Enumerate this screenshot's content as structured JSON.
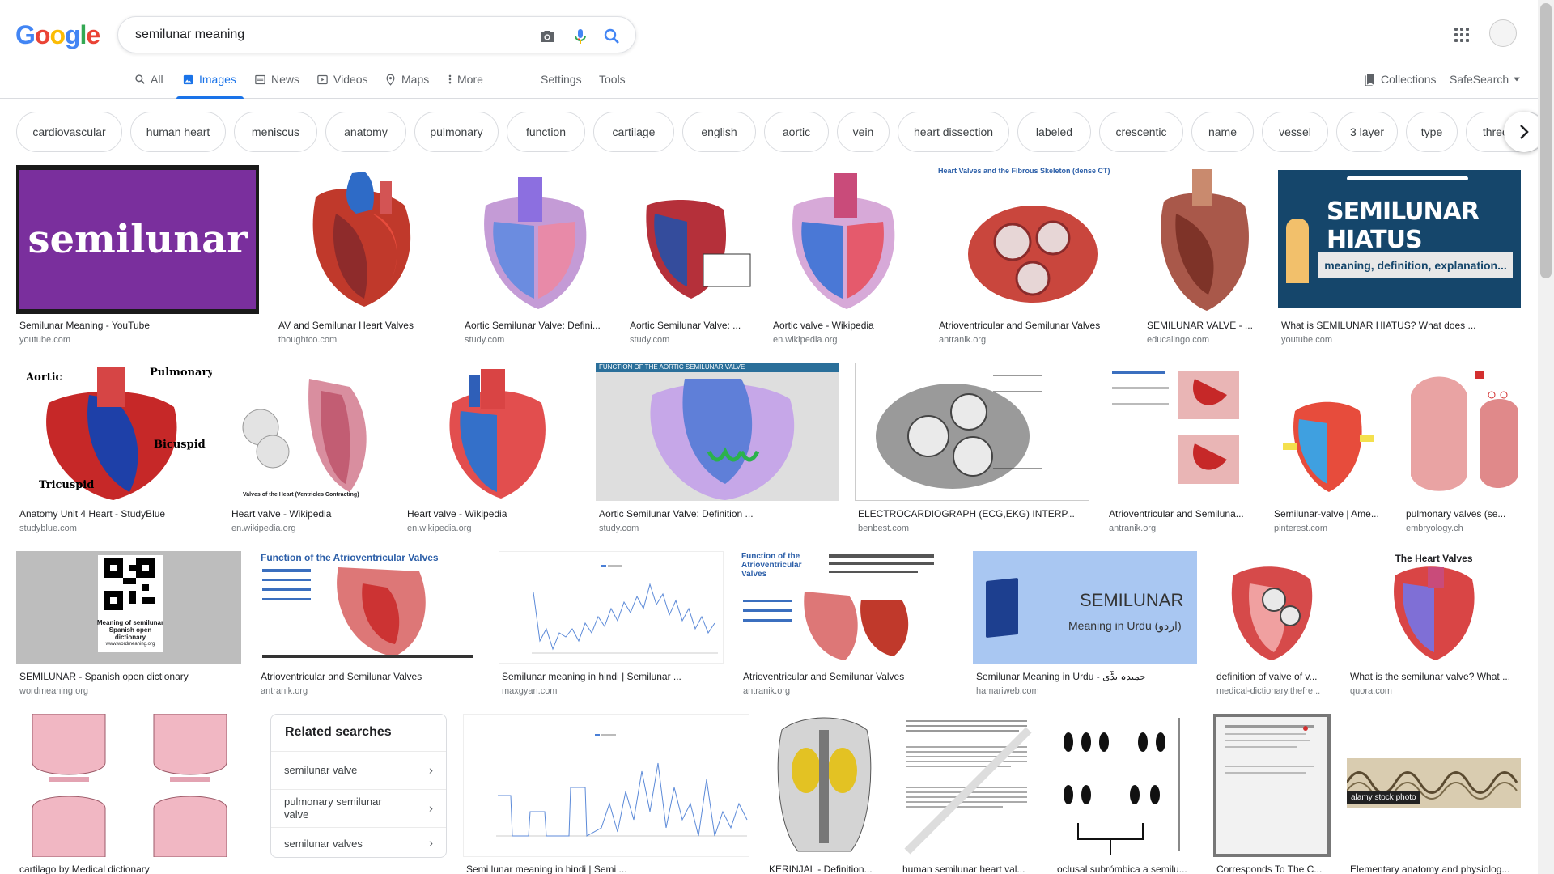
{
  "logo": {
    "letters": [
      "G",
      "o",
      "o",
      "g",
      "l",
      "e"
    ],
    "colors": [
      "#4285f4",
      "#ea4335",
      "#fbbc05",
      "#4285f4",
      "#34a853",
      "#ea4335"
    ]
  },
  "search": {
    "query": "semilunar meaning"
  },
  "tabs": [
    {
      "label": "All",
      "icon": "search-icon"
    },
    {
      "label": "Images",
      "icon": "image-icon"
    },
    {
      "label": "News",
      "icon": "news-icon"
    },
    {
      "label": "Videos",
      "icon": "video-icon"
    },
    {
      "label": "Maps",
      "icon": "map-icon"
    },
    {
      "label": "More",
      "icon": "more-vert-icon"
    },
    {
      "label": "Settings"
    },
    {
      "label": "Tools"
    }
  ],
  "right_tools": {
    "collections": "Collections",
    "safesearch": "SafeSearch"
  },
  "chips": [
    "cardiovascular",
    "human heart",
    "meniscus",
    "anatomy",
    "pulmonary",
    "function",
    "cartilage",
    "english",
    "aortic",
    "vein",
    "heart dissection",
    "labeled",
    "crescentic",
    "name",
    "vessel",
    "3 layer",
    "type",
    "three flap"
  ],
  "results_row1": [
    {
      "caption": "Semilunar Meaning - YouTube",
      "source": "youtube.com",
      "overlay": "semilunar"
    },
    {
      "caption": "AV and Semilunar Heart Valves",
      "source": "thoughtco.com"
    },
    {
      "caption": "Aortic Semilunar Valve: Defini...",
      "source": "study.com"
    },
    {
      "caption": "Aortic Semilunar Valve: ...",
      "source": "study.com"
    },
    {
      "caption": "Aortic valve - Wikipedia",
      "source": "en.wikipedia.org"
    },
    {
      "caption": "Atrioventricular and Semilunar Valves",
      "source": "antranik.org",
      "overlay": "Heart Valves and the Fibrous Skeleton (dense CT)"
    },
    {
      "caption": "SEMILUNAR VALVE - ...",
      "source": "educalingo.com"
    },
    {
      "caption": "What is SEMILUNAR HIATUS? What does ...",
      "source": "youtube.com",
      "overlay": "SEMILUNAR HIATUS",
      "overlay2": "meaning, definition, explanation..."
    }
  ],
  "results_row2": [
    {
      "caption": "Anatomy Unit 4 Heart - StudyBlue",
      "source": "studyblue.com"
    },
    {
      "caption": "Heart valve - Wikipedia",
      "source": "en.wikipedia.org",
      "overlay": "Valves of the Heart (Ventricles Contracting)"
    },
    {
      "caption": "Heart valve - Wikipedia",
      "source": "en.wikipedia.org"
    },
    {
      "caption": "Aortic Semilunar Valve: Definition ...",
      "source": "study.com",
      "overlay": "FUNCTION OF THE AORTIC SEMILUNAR VALVE"
    },
    {
      "caption": "ELECTROCARDIOGRAPH (ECG,EKG) INTERP...",
      "source": "benbest.com"
    },
    {
      "caption": "Atrioventricular and Semiluna...",
      "source": "antranik.org"
    },
    {
      "caption": "Semilunar-valve | Ame...",
      "source": "pinterest.com"
    },
    {
      "caption": "pulmonary valves (se...",
      "source": "embryology.ch"
    }
  ],
  "results_row3": [
    {
      "caption": "SEMILUNAR - Spanish open dictionary",
      "source": "wordmeaning.org",
      "overlay": "Meaning of semilunar",
      "overlay2": "Spanish open dictionary",
      "overlay3": "www.wordmeaning.org"
    },
    {
      "caption": "Atrioventricular and Semilunar Valves",
      "source": "antranik.org",
      "overlay": "Function of the Atrioventricular Valves"
    },
    {
      "caption": "Semilunar meaning in hindi | Semilunar ...",
      "source": "maxgyan.com"
    },
    {
      "caption": "Atrioventricular and Semilunar Valves",
      "source": "antranik.org",
      "overlay": "Function of the Atrioventricular Valves"
    },
    {
      "caption": "Semilunar Meaning in Urdu - حمیدہ بڈّی",
      "source": "hamariweb.com",
      "overlay": "SEMILUNAR",
      "overlay2": "Meaning in Urdu (اردو)"
    },
    {
      "caption": "definition of valve of v...",
      "source": "medical-dictionary.thefre..."
    },
    {
      "caption": "What is the semilunar valve? What ...",
      "source": "quora.com",
      "overlay": "The Heart Valves"
    }
  ],
  "results_row4": [
    {
      "caption": "cartilago by Medical dictionary"
    },
    {
      "caption": "Semi lunar meaning in hindi | Semi ..."
    },
    {
      "caption": "KERINJAL - Definition..."
    },
    {
      "caption": "human semilunar heart val..."
    },
    {
      "caption": "oclusal subrómbica a semilu..."
    },
    {
      "caption": "Corresponds To The C..."
    },
    {
      "caption": "Elementary anatomy and physiolog...",
      "overlay": "alamy stock photo"
    }
  ],
  "related": {
    "title": "Related searches",
    "items": [
      "semilunar valve",
      "pulmonary semilunar valve",
      "semilunar valves"
    ]
  }
}
